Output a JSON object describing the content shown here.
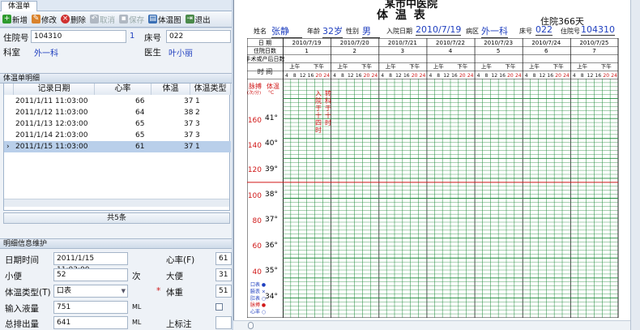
{
  "tab": {
    "label": "体温单"
  },
  "toolbar": {
    "new": "新增",
    "edit": "修改",
    "delete": "删除",
    "cancel": "取消",
    "save": "保存",
    "chart": "体温图",
    "exit": "退出"
  },
  "patient": {
    "admission_label": "住院号",
    "admission_value": "104310",
    "admission_suffix": "1",
    "bed_label": "床号",
    "bed_value": "022",
    "dept_label": "科室",
    "dept_value": "外一科",
    "doctor_label": "医生",
    "doctor_value": "叶小丽"
  },
  "list_section": {
    "title": "体温单明细"
  },
  "table": {
    "headers": [
      "记录日期",
      "心率",
      "体温",
      "体温类型"
    ],
    "rows": [
      {
        "date": "2011/1/11 11:03:00",
        "hr": "66",
        "temp": "37",
        "type": "1"
      },
      {
        "date": "2011/1/12 11:03:00",
        "hr": "64",
        "temp": "38",
        "type": "2"
      },
      {
        "date": "2011/1/13 12:03:00",
        "hr": "65",
        "temp": "37",
        "type": "3"
      },
      {
        "date": "2011/1/14 21:03:00",
        "hr": "65",
        "temp": "37",
        "type": "3"
      },
      {
        "date": "2011/1/15 11:03:00",
        "hr": "61",
        "temp": "37",
        "type": "1"
      }
    ],
    "pager": "共5条"
  },
  "detail_section": {
    "title": "明细信息维护"
  },
  "detail": {
    "datetime_label": "日期时间",
    "datetime_value": "2011/1/15 11:03:00",
    "hr_label": "心率(F)",
    "hr_value": "61",
    "stool_label": "小便",
    "stool_value": "52",
    "stool_unit": "次",
    "bigstool_label": "大便",
    "bigstool_value": "31",
    "ttype_label": "体温类型(T)",
    "ttype_value": "口表",
    "temp_label": "体重",
    "temp_value": "51",
    "required_mark": "*",
    "intake_label": "输入液量",
    "intake_value": "751",
    "intake_unit": "ML",
    "output_label": "总排出量",
    "output_value": "641",
    "output_unit": "ML",
    "upper_label": "上标注"
  },
  "doc": {
    "hospital": "某市中医院",
    "title": "体 温 表",
    "stay": "住院366天",
    "name_label": "姓名",
    "name": "张静",
    "age_label": "年龄",
    "age": "32岁",
    "sex_label": "性别",
    "sex": "男",
    "admit_label": "入院日期",
    "admit": "2010/7/19",
    "ward_label": "病区",
    "ward": "外一科",
    "bed_label": "床号",
    "bed": "022",
    "no_label": "住院号",
    "no": "104310",
    "row_date": "日 期",
    "row_days": "住院日数",
    "row_op": "手术或产后日数",
    "row_time": "时 间",
    "dates": [
      "2010/7/19",
      "2010/7/20",
      "2010/7/21",
      "2010/7/22",
      "2010/7/23",
      "2010/7/24",
      "2010/7/25"
    ],
    "days": [
      "1",
      "2",
      "3",
      "4",
      "5",
      "6",
      "7"
    ],
    "am": "上午",
    "pm": "下午",
    "hours": [
      "4",
      "8",
      "12",
      "16",
      "20",
      "24"
    ],
    "pulse_label": "脉搏",
    "pulse_unit": "(次/分)",
    "temp_label": "体温",
    "temp_unit": "°C",
    "pulse_ticks": [
      "160",
      "140",
      "120",
      "100",
      "80",
      "60",
      "40"
    ],
    "temp_ticks": [
      "41°",
      "40°",
      "39°",
      "38°",
      "37°",
      "36°",
      "35°",
      "34°"
    ],
    "legend": [
      "口表 ●",
      "腋表 ×",
      "肛表 ○",
      "脉搏 ●",
      "心率 ○"
    ],
    "note1": "入院于十四时",
    "note2": "转科于十时"
  },
  "colors": {
    "accent": "#1f3fbf",
    "red": "#d01818",
    "grid": "#1e8a3a"
  }
}
